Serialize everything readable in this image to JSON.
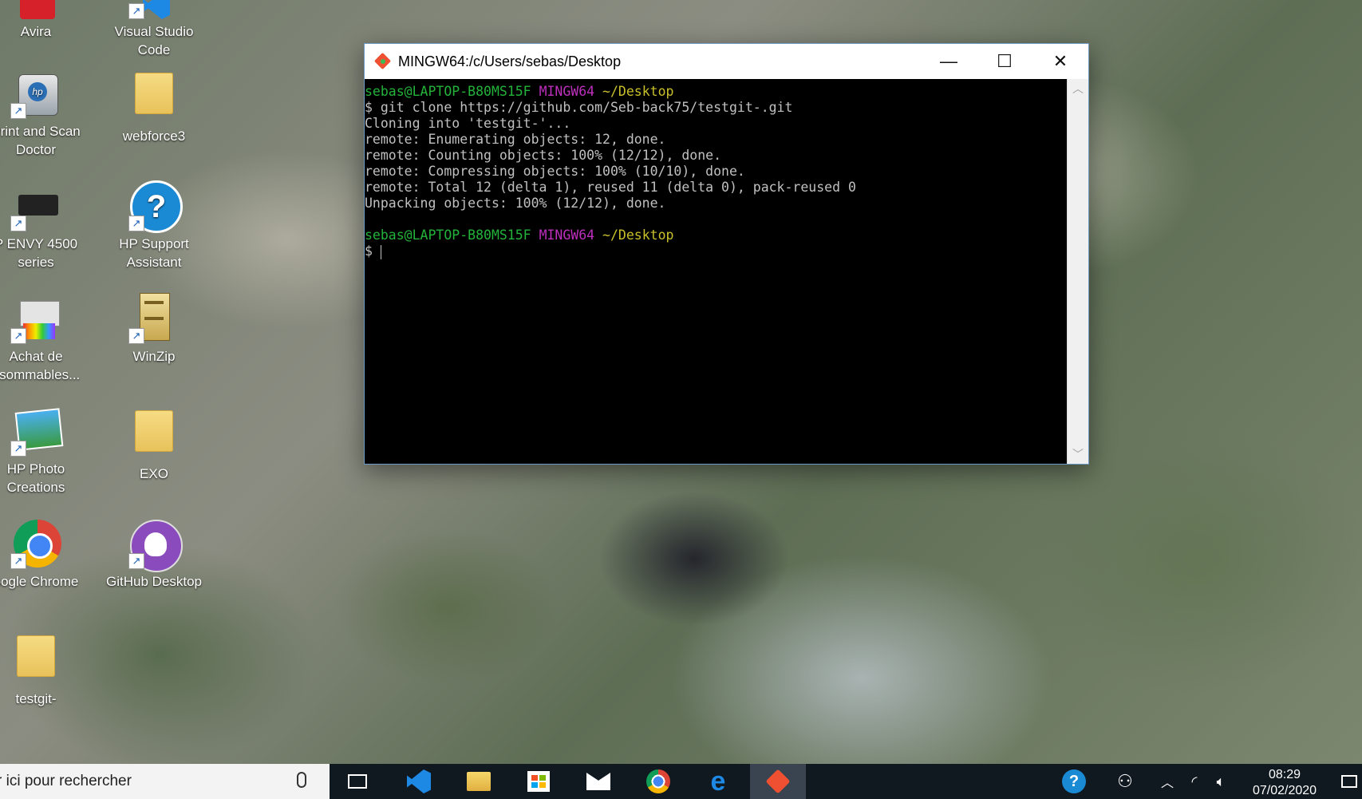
{
  "desktop": {
    "icons": [
      {
        "label": "Avira"
      },
      {
        "label": "Visual Studio Code"
      },
      {
        "label": "Print and Scan Doctor"
      },
      {
        "label": "webforce3"
      },
      {
        "label": "P ENVY 4500 series"
      },
      {
        "label": "HP Support Assistant"
      },
      {
        "label": "Achat de nsommables..."
      },
      {
        "label": "WinZip"
      },
      {
        "label": "HP Photo Creations"
      },
      {
        "label": "EXO"
      },
      {
        "label": "oogle Chrome"
      },
      {
        "label": "GitHub Desktop"
      },
      {
        "label": "testgit-"
      }
    ]
  },
  "window": {
    "title": "MINGW64:/c/Users/sebas/Desktop",
    "minimize_glyph": "—",
    "maximize_glyph": "☐",
    "close_glyph": "✕"
  },
  "terminal": {
    "prompt1": {
      "user": "sebas@LAPTOP-B80MS15F",
      "env": "MINGW64",
      "path": "~/Desktop"
    },
    "lines": [
      "$ git clone https://github.com/Seb-back75/testgit-.git",
      "Cloning into 'testgit-'...",
      "remote: Enumerating objects: 12, done.",
      "remote: Counting objects: 100% (12/12), done.",
      "remote: Compressing objects: 100% (10/10), done.",
      "remote: Total 12 (delta 1), reused 11 (delta 0), pack-reused 0",
      "Unpacking objects: 100% (12/12), done."
    ],
    "prompt2": {
      "user": "sebas@LAPTOP-B80MS15F",
      "env": "MINGW64",
      "path": "~/Desktop"
    },
    "input_prefix": "$ "
  },
  "taskbar": {
    "search_placeholder": "r ici pour rechercher",
    "time": "08:29",
    "date": "07/02/2020"
  },
  "colors": {
    "prompt_user": "#23b33a",
    "prompt_env": "#bd2fbd",
    "prompt_path": "#c9c02a"
  }
}
